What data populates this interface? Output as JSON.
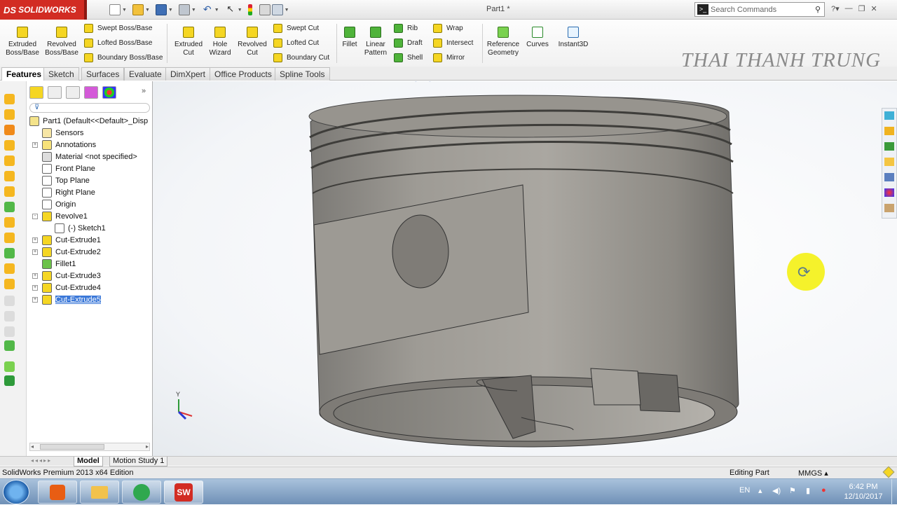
{
  "app": {
    "logo": "SOLIDWORKS",
    "document_title": "Part1 *",
    "search_placeholder": "Search Commands",
    "watermark": "THAI THANH TRUNG"
  },
  "ribbon": {
    "big_buttons": [
      {
        "line1": "Extruded",
        "line2": "Boss/Base"
      },
      {
        "line1": "Revolved",
        "line2": "Boss/Base"
      },
      {
        "line1": "Extruded",
        "line2": "Cut"
      },
      {
        "line1": "Hole",
        "line2": "Wizard"
      },
      {
        "line1": "Revolved",
        "line2": "Cut"
      },
      {
        "line1": "Fillet",
        "line2": ""
      },
      {
        "line1": "Linear",
        "line2": "Pattern"
      },
      {
        "line1": "Reference",
        "line2": "Geometry"
      },
      {
        "line1": "Curves",
        "line2": ""
      },
      {
        "line1": "Instant3D",
        "line2": ""
      }
    ],
    "small_buttons": [
      "Swept Boss/Base",
      "Lofted Boss/Base",
      "Boundary Boss/Base",
      "Swept Cut",
      "Lofted Cut",
      "Boundary Cut",
      "Rib",
      "Draft",
      "Shell",
      "Wrap",
      "Intersect",
      "Mirror"
    ]
  },
  "tabs": [
    "Features",
    "Sketch",
    "Surfaces",
    "Evaluate",
    "DimXpert",
    "Office Products",
    "Spline Tools"
  ],
  "active_tab": "Features",
  "feature_tree": [
    {
      "label": "Part1  (Default<<Default>_Disp",
      "icon": "part-icon",
      "expand": ""
    },
    {
      "label": "Sensors",
      "icon": "sensors-icon",
      "expand": ""
    },
    {
      "label": "Annotations",
      "icon": "annotations-icon",
      "expand": "+"
    },
    {
      "label": "Material <not specified>",
      "icon": "material-icon",
      "expand": ""
    },
    {
      "label": "Front Plane",
      "icon": "plane-icon",
      "expand": ""
    },
    {
      "label": "Top Plane",
      "icon": "plane-icon",
      "expand": ""
    },
    {
      "label": "Right Plane",
      "icon": "plane-icon",
      "expand": ""
    },
    {
      "label": "Origin",
      "icon": "origin-icon",
      "expand": ""
    },
    {
      "label": "Revolve1",
      "icon": "revolve-icon",
      "expand": "-"
    },
    {
      "label": "(-) Sketch1",
      "icon": "sketch-icon",
      "expand": ""
    },
    {
      "label": "Cut-Extrude1",
      "icon": "cut-extrude-icon",
      "expand": "+"
    },
    {
      "label": "Cut-Extrude2",
      "icon": "cut-extrude-icon",
      "expand": "+"
    },
    {
      "label": "Fillet1",
      "icon": "fillet-icon",
      "expand": ""
    },
    {
      "label": "Cut-Extrude3",
      "icon": "cut-extrude-icon",
      "expand": "+"
    },
    {
      "label": "Cut-Extrude4",
      "icon": "cut-extrude-icon",
      "expand": "+"
    },
    {
      "label": "Cut-Extrude5",
      "icon": "cut-extrude-icon",
      "expand": "+",
      "selected": true
    }
  ],
  "bottom_tabs": [
    "Model",
    "Motion Study 1"
  ],
  "triad": {
    "axis_y": "Y"
  },
  "status": {
    "left": "SolidWorks Premium 2013 x64 Edition",
    "mode": "Editing Part",
    "units": "MMGS"
  },
  "taskbar": {
    "language": "EN",
    "time": "6:42 PM",
    "date": "12/10/2017"
  },
  "colors": {
    "brand_red": "#d22c23",
    "selection_blue": "#3b78d8",
    "model_gray": "#8d8a84",
    "rotate_cursor": "#f4f120"
  }
}
